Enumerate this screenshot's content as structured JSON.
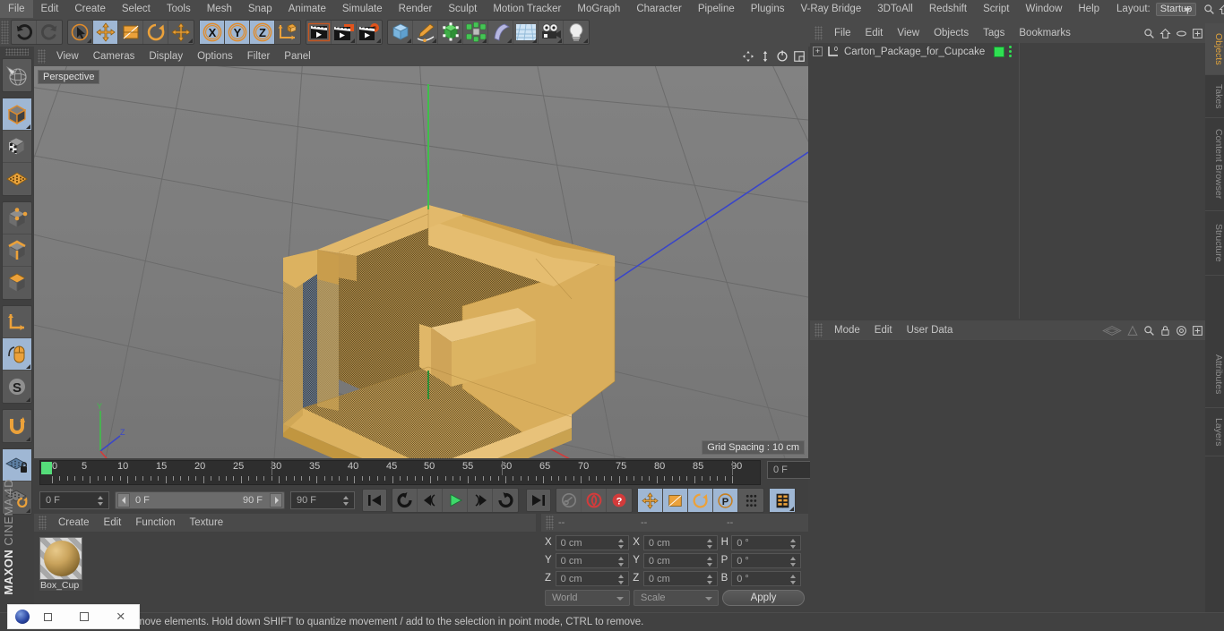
{
  "app": {
    "title": "MAXON CINEMA 4D",
    "brand_primary": "MAXON",
    "brand_secondary": "CINEMA 4D"
  },
  "menubar": {
    "items": [
      {
        "label": "File"
      },
      {
        "label": "Edit"
      },
      {
        "label": "Create"
      },
      {
        "label": "Select"
      },
      {
        "label": "Tools"
      },
      {
        "label": "Mesh"
      },
      {
        "label": "Snap"
      },
      {
        "label": "Animate"
      },
      {
        "label": "Simulate"
      },
      {
        "label": "Render"
      },
      {
        "label": "Sculpt"
      },
      {
        "label": "Motion Tracker"
      },
      {
        "label": "MoGraph"
      },
      {
        "label": "Character"
      },
      {
        "label": "Pipeline"
      },
      {
        "label": "Plugins"
      },
      {
        "label": "V-Ray Bridge"
      },
      {
        "label": "3DToAll"
      },
      {
        "label": "Redshift"
      },
      {
        "label": "Script"
      },
      {
        "label": "Window"
      },
      {
        "label": "Help"
      }
    ],
    "layout_label": "Layout:",
    "layout_value": "Startup"
  },
  "toolbar": {
    "groups": [
      {
        "name": "history",
        "buttons": [
          {
            "icon": "undo-icon",
            "active": false,
            "enabled": true
          },
          {
            "icon": "redo-icon",
            "active": false,
            "enabled": false
          }
        ]
      },
      {
        "name": "transform-tools",
        "buttons": [
          {
            "icon": "live-selection-icon",
            "active": false,
            "enabled": true
          },
          {
            "icon": "move-tool-icon",
            "active": true,
            "enabled": true
          },
          {
            "icon": "scale-tool-icon",
            "active": false,
            "enabled": true
          },
          {
            "icon": "rotate-tool-icon",
            "active": false,
            "enabled": true
          },
          {
            "icon": "move-alt-icon",
            "active": false,
            "enabled": true
          }
        ]
      },
      {
        "name": "axis-locks",
        "buttons": [
          {
            "icon": "axis-x-icon",
            "active": true,
            "enabled": true
          },
          {
            "icon": "axis-y-icon",
            "active": true,
            "enabled": true
          },
          {
            "icon": "axis-z-icon",
            "active": true,
            "enabled": true
          },
          {
            "icon": "world-object-axis-icon",
            "active": false,
            "enabled": true
          }
        ]
      },
      {
        "name": "render-tools",
        "buttons": [
          {
            "icon": "render-view-icon",
            "active": false,
            "enabled": true
          },
          {
            "icon": "render-to-picture-viewer-icon",
            "active": false,
            "enabled": true
          },
          {
            "icon": "render-settings-icon",
            "active": false,
            "enabled": true
          }
        ]
      },
      {
        "name": "create-objects",
        "buttons": [
          {
            "icon": "cube-primitive-icon",
            "active": false,
            "enabled": true
          },
          {
            "icon": "spline-pen-icon",
            "active": false,
            "enabled": true
          },
          {
            "icon": "nurbs-generator-icon",
            "active": false,
            "enabled": true
          },
          {
            "icon": "array-modeling-icon",
            "active": false,
            "enabled": true
          },
          {
            "icon": "deformer-bend-icon",
            "active": false,
            "enabled": true
          },
          {
            "icon": "floor-environment-icon",
            "active": false,
            "enabled": true
          },
          {
            "icon": "camera-icon",
            "active": false,
            "enabled": true
          },
          {
            "icon": "light-icon",
            "active": false,
            "enabled": true
          }
        ]
      }
    ]
  },
  "left_toolbar": {
    "groups": [
      {
        "name": "selection-modes",
        "buttons": [
          {
            "icon": "make-editable-icon",
            "active": false
          }
        ]
      },
      {
        "name": "component-modes",
        "buttons": [
          {
            "icon": "model-mode-icon",
            "active": true
          },
          {
            "icon": "texture-mode-icon",
            "active": false
          },
          {
            "icon": "workplane-mode-icon",
            "active": false
          }
        ]
      },
      {
        "name": "element-modes",
        "buttons": [
          {
            "icon": "point-mode-icon",
            "active": false
          },
          {
            "icon": "edge-mode-icon",
            "active": false
          },
          {
            "icon": "polygon-mode-icon",
            "active": false
          }
        ]
      },
      {
        "name": "axis-tools",
        "buttons": [
          {
            "icon": "enable-axis-modification-icon",
            "active": false
          },
          {
            "icon": "viewport-solo-single-icon",
            "active": true
          },
          {
            "icon": "snap-enable-icon",
            "active": false
          }
        ]
      },
      {
        "name": "magnet-tools",
        "buttons": [
          {
            "icon": "magnet-tool-icon",
            "active": false
          }
        ]
      },
      {
        "name": "workplane-tools",
        "buttons": [
          {
            "icon": "workplane-lock-icon",
            "active": true
          },
          {
            "icon": "workplane-rotate-icon",
            "active": false
          }
        ]
      }
    ]
  },
  "viewport": {
    "menu": [
      {
        "label": "View"
      },
      {
        "label": "Cameras"
      },
      {
        "label": "Display"
      },
      {
        "label": "Options"
      },
      {
        "label": "Filter"
      },
      {
        "label": "Panel"
      }
    ],
    "corner_icons": [
      {
        "icon": "pan-viewport-icon"
      },
      {
        "icon": "dolly-viewport-icon"
      },
      {
        "icon": "rotate-viewport-icon"
      },
      {
        "icon": "maximize-viewport-icon"
      }
    ],
    "label": "Perspective",
    "grid_spacing": "Grid Spacing : 10 cm",
    "axis_colors": {
      "x": "#d33b3b",
      "y": "#3fbf4a",
      "z": "#3a46c8"
    },
    "model_color": "#dcb260",
    "background_color": "#7d7d7d"
  },
  "timeline": {
    "ruler_labels": [
      "0",
      "5",
      "10",
      "15",
      "20",
      "25",
      "30",
      "35",
      "40",
      "45",
      "50",
      "55",
      "60",
      "65",
      "70",
      "75",
      "80",
      "85",
      "90"
    ],
    "ruler_min": 0,
    "ruler_max": 90,
    "current_frame_field": "0 F",
    "playhead_frame": 0,
    "start_frame_field": "0 F",
    "range_start": "0 F",
    "range_end": "90 F",
    "end_frame_field": "90 F",
    "transport": [
      {
        "icon": "go-to-start-icon",
        "active": false
      },
      {
        "icon": "play-back-loop-icon",
        "active": false
      },
      {
        "icon": "step-back-icon",
        "active": false
      },
      {
        "icon": "play-forward-icon",
        "active": false
      },
      {
        "icon": "step-forward-icon",
        "active": false
      },
      {
        "icon": "play-forward-loop-icon",
        "active": false
      },
      {
        "icon": "go-to-end-icon",
        "active": false
      }
    ],
    "keyframe_tools": [
      {
        "icon": "record-active-objects-icon",
        "active": false,
        "enabled": false
      },
      {
        "icon": "autokeying-icon",
        "active": false,
        "enabled": true
      },
      {
        "icon": "keyframe-selection-icon",
        "active": false,
        "enabled": true
      }
    ],
    "key_toggles": [
      {
        "icon": "position-key-icon",
        "active": true
      },
      {
        "icon": "scale-key-icon",
        "active": true
      },
      {
        "icon": "rotation-key-icon",
        "active": true
      },
      {
        "icon": "param-key-icon",
        "active": true
      },
      {
        "icon": "point-level-animation-icon",
        "active": true
      }
    ],
    "timeline_view_button": {
      "icon": "timeline-view-icon",
      "active": true
    }
  },
  "material_manager": {
    "menu": [
      {
        "label": "Create"
      },
      {
        "label": "Edit"
      },
      {
        "label": "Function"
      },
      {
        "label": "Texture"
      }
    ],
    "materials": [
      {
        "name": "Box_Cup",
        "color": "#c9a35c"
      }
    ]
  },
  "coordinates": {
    "headers": [
      "--",
      "--",
      "--"
    ],
    "rows": [
      {
        "label_a": "X",
        "value_a": "0 cm",
        "label_b": "X",
        "value_b": "0 cm",
        "label_c": "H",
        "value_c": "0 °"
      },
      {
        "label_a": "Y",
        "value_a": "0 cm",
        "label_b": "Y",
        "value_b": "0 cm",
        "label_c": "P",
        "value_c": "0 °"
      },
      {
        "label_a": "Z",
        "value_a": "0 cm",
        "label_b": "Z",
        "value_b": "0 cm",
        "label_c": "B",
        "value_c": "0 °"
      }
    ],
    "space_select": "World",
    "mode_select": "Scale",
    "apply_label": "Apply"
  },
  "object_manager": {
    "menu": [
      {
        "label": "File"
      },
      {
        "label": "Edit"
      },
      {
        "label": "View"
      },
      {
        "label": "Objects"
      },
      {
        "label": "Tags"
      },
      {
        "label": "Bookmarks"
      }
    ],
    "corner_icons": [
      {
        "icon": "search-icon"
      },
      {
        "icon": "home-icon"
      },
      {
        "icon": "ellipse-icon"
      },
      {
        "icon": "add-panel-icon"
      }
    ],
    "objects": [
      {
        "name": "Carton_Package_for_Cupcake",
        "type": "null-object",
        "visible": true,
        "tag_color": "#2fe052"
      }
    ]
  },
  "attribute_manager": {
    "menu": [
      {
        "label": "Mode"
      },
      {
        "label": "Edit"
      },
      {
        "label": "User Data"
      }
    ],
    "corner_icons": [
      {
        "icon": "pin-layout-icon"
      },
      {
        "icon": "lock-attributes-icon"
      },
      {
        "icon": "search-icon"
      },
      {
        "icon": "padlock-icon"
      },
      {
        "icon": "target-icon"
      },
      {
        "icon": "add-panel-icon"
      }
    ]
  },
  "right_tabs": [
    {
      "label": "Objects",
      "active": true
    },
    {
      "label": "Takes",
      "active": false
    },
    {
      "label": "Content Browser",
      "active": false
    },
    {
      "label": "Structure",
      "active": false
    },
    {
      "label": "Attributes",
      "active": true
    },
    {
      "label": "Layers",
      "active": false
    }
  ],
  "statusbar": {
    "text": "move elements. Hold down SHIFT to quantize movement / add to the selection in point mode, CTRL to remove."
  },
  "window_chrome": {
    "restore_label": "",
    "close_label": "×"
  }
}
